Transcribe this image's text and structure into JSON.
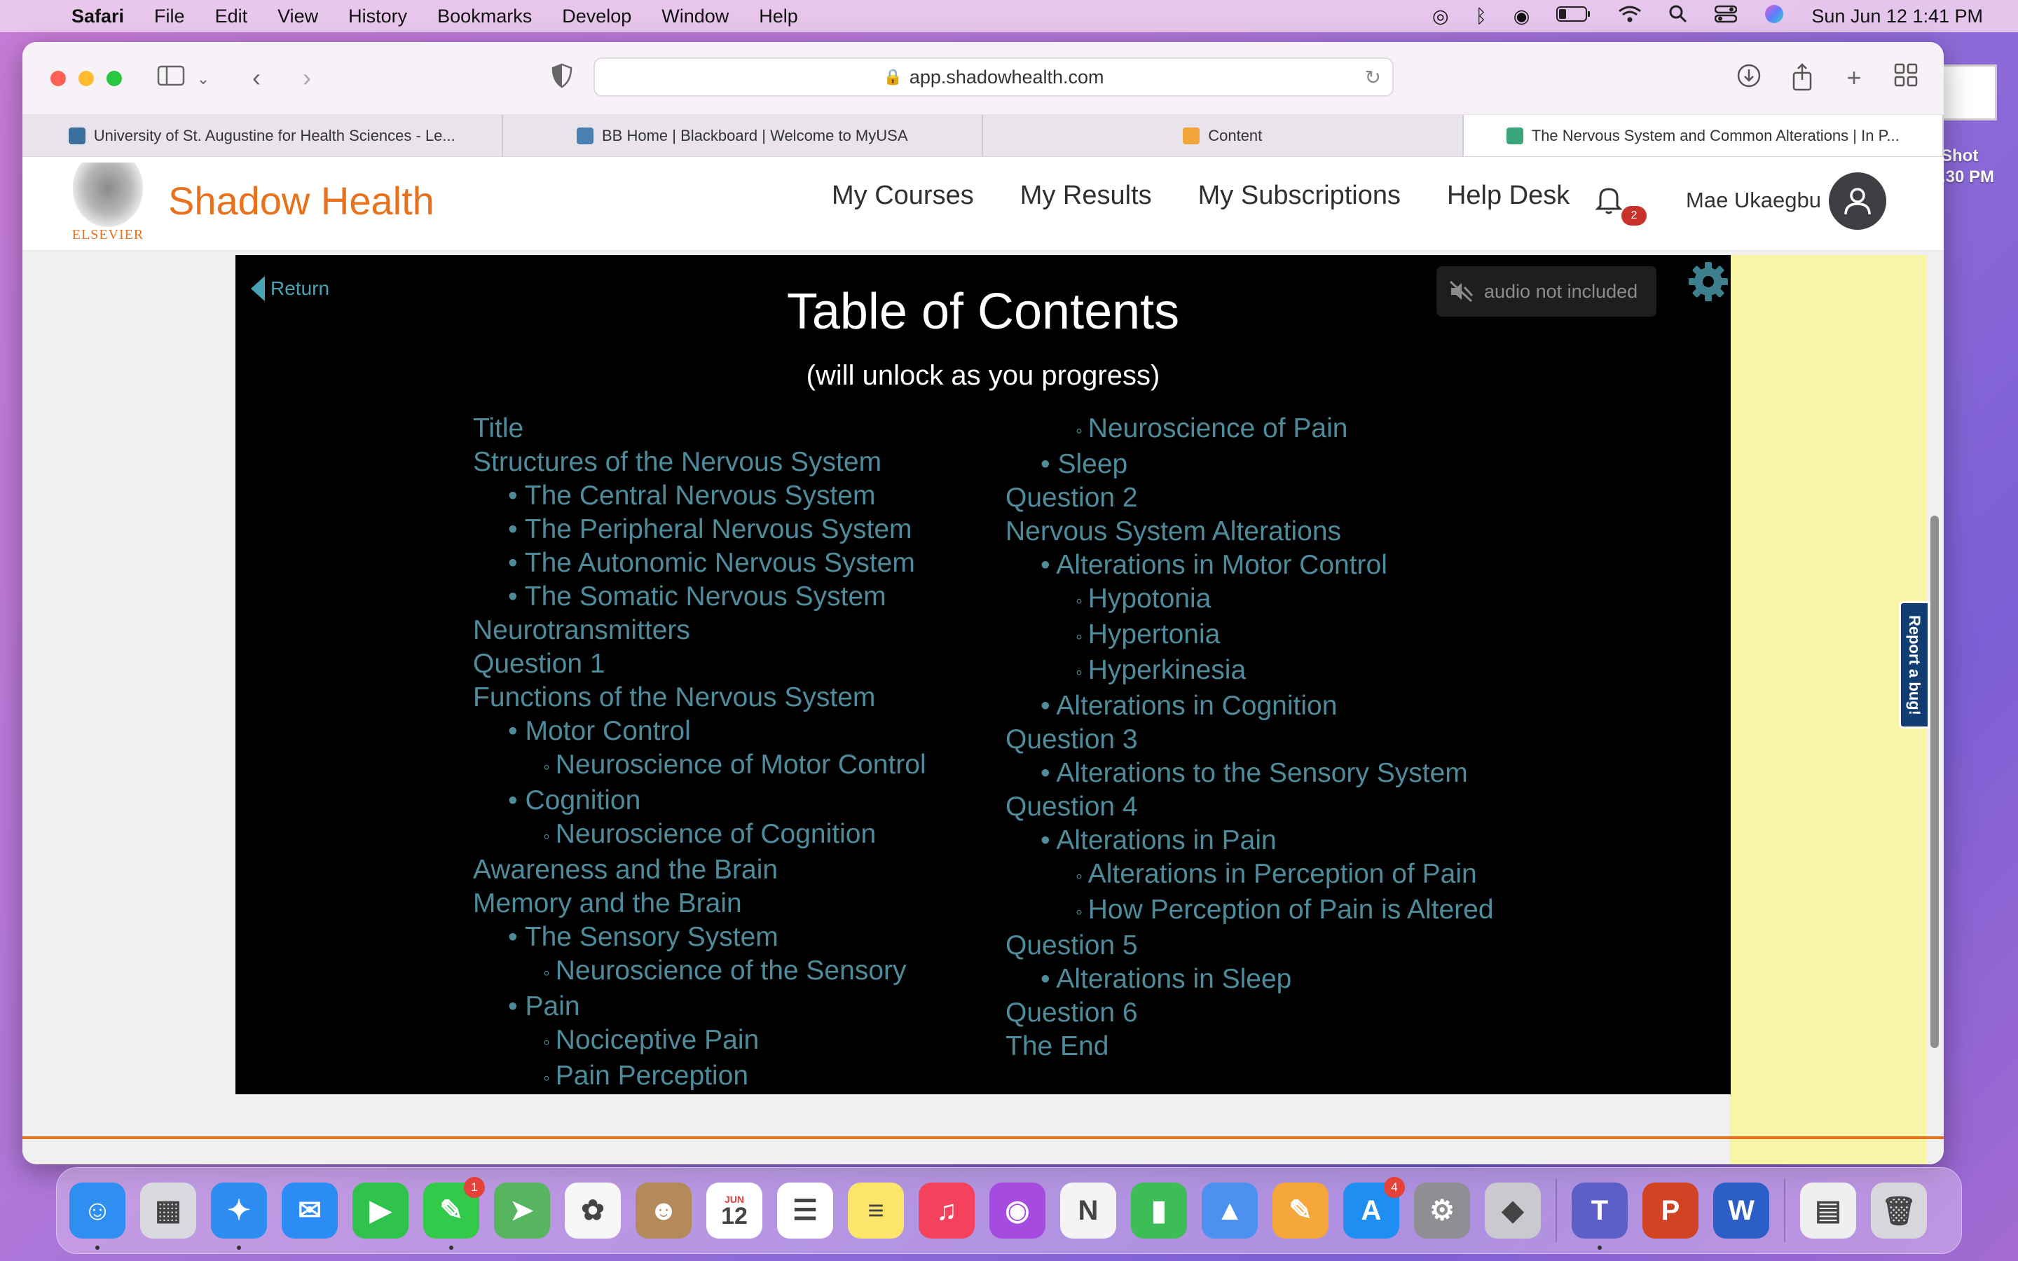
{
  "menubar": {
    "app": "Safari",
    "items": [
      "File",
      "Edit",
      "View",
      "History",
      "Bookmarks",
      "Develop",
      "Window",
      "Help"
    ],
    "datetime": "Sun Jun 12  1:41 PM"
  },
  "browser": {
    "address": "app.shadowhealth.com",
    "tabs": [
      {
        "label": "University of St. Augustine for Health Sciences - Le...",
        "color": "#3d6f9e"
      },
      {
        "label": "BB Home | Blackboard | Welcome to MyUSA",
        "color": "#4a7fb2"
      },
      {
        "label": "Content",
        "color": "#f0a53a"
      },
      {
        "label": "The Nervous System and Common Alterations | In P...",
        "color": "#3aa67b"
      }
    ]
  },
  "site": {
    "publisher": "ELSEVIER",
    "brand": "Shadow Health",
    "nav": [
      "My Courses",
      "My Results",
      "My Subscriptions",
      "Help Desk"
    ],
    "notifications": "2",
    "user": "Mae Ukaegbu",
    "report_bug": "Report a bug!"
  },
  "player": {
    "return_label": "Return",
    "audio_label": "audio not included",
    "title": "Table of Contents",
    "subtitle": "(will unlock as you progress)",
    "toc_left": [
      {
        "text": "Title",
        "level": 0
      },
      {
        "text": "Structures of the Nervous System",
        "level": 0
      },
      {
        "text": "The Central Nervous System",
        "level": 1
      },
      {
        "text": "The Peripheral Nervous System",
        "level": 1
      },
      {
        "text": "The Autonomic Nervous System",
        "level": 1
      },
      {
        "text": "The Somatic Nervous System",
        "level": 1
      },
      {
        "text": "Neurotransmitters",
        "level": 0
      },
      {
        "text": "Question 1",
        "level": 0
      },
      {
        "text": "Functions of the Nervous System",
        "level": 0
      },
      {
        "text": "Motor Control",
        "level": 1
      },
      {
        "text": "Neuroscience of Motor Control",
        "level": 2
      },
      {
        "text": "Cognition",
        "level": 1
      },
      {
        "text": "Neuroscience of Cognition",
        "level": 2
      },
      {
        "text": "Awareness and the Brain",
        "level": 0
      },
      {
        "text": "Memory and the Brain",
        "level": 0
      },
      {
        "text": "The Sensory System",
        "level": 1
      },
      {
        "text": "Neuroscience of the Sensory",
        "level": 2
      },
      {
        "text": "Pain",
        "level": 1
      },
      {
        "text": "Nociceptive Pain",
        "level": 2
      },
      {
        "text": "Pain Perception",
        "level": 2
      }
    ],
    "toc_right": [
      {
        "text": "Neuroscience of Pain",
        "level": 2
      },
      {
        "text": "Sleep",
        "level": 1
      },
      {
        "text": "Question 2",
        "level": 0
      },
      {
        "text": "Nervous System Alterations",
        "level": 0
      },
      {
        "text": "Alterations in Motor Control",
        "level": 1
      },
      {
        "text": "Hypotonia",
        "level": 2
      },
      {
        "text": "Hypertonia",
        "level": 2
      },
      {
        "text": "Hyperkinesia",
        "level": 2
      },
      {
        "text": "Alterations in Cognition",
        "level": 1
      },
      {
        "text": "Question 3",
        "level": 0
      },
      {
        "text": "Alterations to the Sensory System",
        "level": 1
      },
      {
        "text": "Question 4",
        "level": 0
      },
      {
        "text": "Alterations in Pain",
        "level": 1
      },
      {
        "text": "Alterations in Perception of Pain",
        "level": 2
      },
      {
        "text": "How Perception of Pain is Altered",
        "level": 2
      },
      {
        "text": "Question 5",
        "level": 0
      },
      {
        "text": "Alterations in Sleep",
        "level": 1
      },
      {
        "text": "Question 6",
        "level": 0
      },
      {
        "text": "The End",
        "level": 0
      }
    ]
  },
  "desktop": {
    "screenshot_label": "Shot",
    "screenshot_time": ".30 PM"
  },
  "dock": {
    "apps": [
      {
        "name": "finder",
        "color": "#2f8ff0",
        "glyph": "☺",
        "running": true
      },
      {
        "name": "launchpad",
        "color": "#d9d9e0",
        "glyph": "▦"
      },
      {
        "name": "safari",
        "color": "#2d8df0",
        "glyph": "✦",
        "running": true
      },
      {
        "name": "mail",
        "color": "#2a8cf4",
        "glyph": "✉"
      },
      {
        "name": "facetime",
        "color": "#2fc24c",
        "glyph": "▶"
      },
      {
        "name": "messages",
        "color": "#33c94a",
        "glyph": "✎",
        "badge": "1",
        "running": true
      },
      {
        "name": "maps",
        "color": "#57b55f",
        "glyph": "➤"
      },
      {
        "name": "photos",
        "color": "#f6f6f6",
        "glyph": "✿"
      },
      {
        "name": "contacts",
        "color": "#b58a5b",
        "glyph": "☻"
      },
      {
        "name": "calendar",
        "color": "#ffffff",
        "glyph": "12",
        "sub": "JUN"
      },
      {
        "name": "reminders",
        "color": "#ffffff",
        "glyph": "☰"
      },
      {
        "name": "notes",
        "color": "#fbe56b",
        "glyph": "≡"
      },
      {
        "name": "music",
        "color": "#f5425c",
        "glyph": "♫"
      },
      {
        "name": "podcasts",
        "color": "#a64be0",
        "glyph": "◉"
      },
      {
        "name": "news",
        "color": "#f4f4f4",
        "glyph": "N"
      },
      {
        "name": "numbers",
        "color": "#3dbd55",
        "glyph": "▮"
      },
      {
        "name": "keynote",
        "color": "#4c90f0",
        "glyph": "▲"
      },
      {
        "name": "pages",
        "color": "#f5a63a",
        "glyph": "✎"
      },
      {
        "name": "app-store",
        "color": "#1f8ef2",
        "glyph": "A",
        "badge": "4"
      },
      {
        "name": "system-preferences",
        "color": "#8e8e93",
        "glyph": "⚙"
      },
      {
        "name": "roblox",
        "color": "#c9c9cf",
        "glyph": "◆"
      },
      {
        "name": "teams",
        "color": "#5b5fc7",
        "glyph": "T",
        "running": true
      },
      {
        "name": "powerpoint",
        "color": "#d04423",
        "glyph": "P"
      },
      {
        "name": "word",
        "color": "#2b5ec7",
        "glyph": "W"
      },
      {
        "name": "pdf-document",
        "color": "#efefef",
        "glyph": "▤"
      },
      {
        "name": "trash",
        "color": "#d6d6dc",
        "glyph": "🗑"
      }
    ]
  }
}
